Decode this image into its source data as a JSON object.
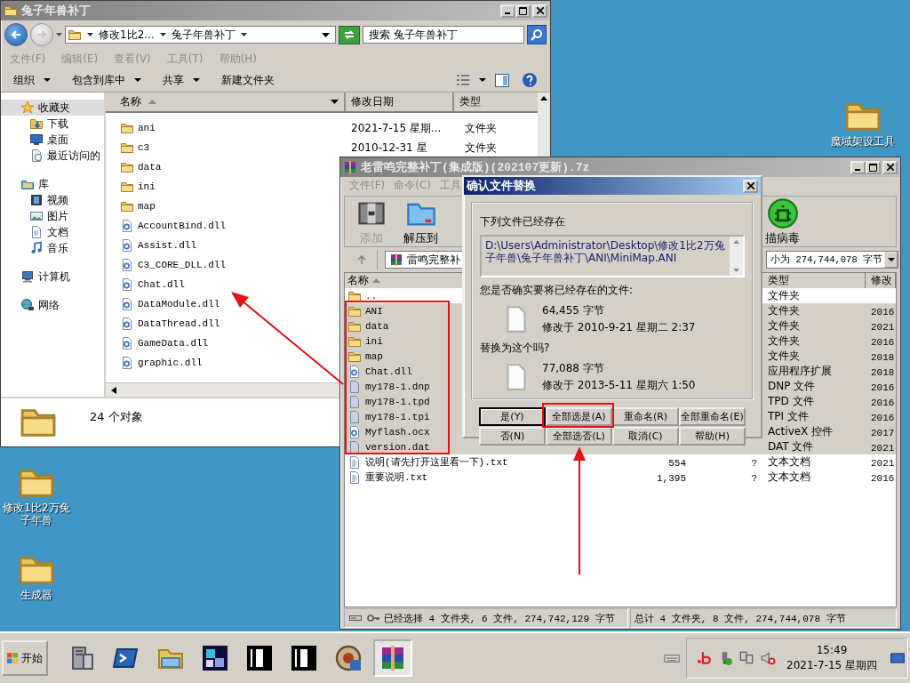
{
  "desktop": {
    "right_icons": [
      {
        "label": "魔域架设工具"
      }
    ],
    "left_icons": [
      {
        "label": "修改1比2万兔子年兽"
      },
      {
        "label": "生成器"
      }
    ]
  },
  "explorer": {
    "title": "兔子年兽补丁",
    "breadcrumbs": [
      "修改1比2...",
      "兔子年兽补丁"
    ],
    "search": {
      "placeholder": "搜索 兔子年兽补丁"
    },
    "menu": [
      "文件(F)",
      "编辑(E)",
      "查看(V)",
      "工具(T)",
      "帮助(H)"
    ],
    "toolbar": [
      {
        "label": "组织",
        "dropdown": true
      },
      {
        "label": "包含到库中",
        "dropdown": true
      },
      {
        "label": "共享",
        "dropdown": true
      },
      {
        "label": "新建文件夹",
        "dropdown": false
      }
    ],
    "sidebar": [
      {
        "label": "收藏夹",
        "kind": "star",
        "selected": true,
        "children": [
          {
            "label": "下载",
            "kind": "download"
          },
          {
            "label": "桌面",
            "kind": "desktop"
          },
          {
            "label": "最近访问的",
            "kind": "recent"
          }
        ]
      },
      {
        "label": "库",
        "kind": "library",
        "selected": false,
        "children": [
          {
            "label": "视频",
            "kind": "video"
          },
          {
            "label": "图片",
            "kind": "picture"
          },
          {
            "label": "文档",
            "kind": "document"
          },
          {
            "label": "音乐",
            "kind": "music"
          }
        ]
      },
      {
        "label": "计算机",
        "kind": "computer",
        "selected": false
      },
      {
        "label": "网络",
        "kind": "network",
        "selected": false
      }
    ],
    "columns": [
      {
        "label": "名称",
        "sorted": true
      },
      {
        "label": "修改日期",
        "sorted": false
      },
      {
        "label": "类型",
        "sorted": false
      }
    ],
    "files": [
      {
        "name": "ani",
        "kind": "folder",
        "date": "2021-7-15 星期...",
        "type": "文件夹"
      },
      {
        "name": "c3",
        "kind": "folder",
        "date": "2010-12-31 星",
        "type": "文件夹"
      },
      {
        "name": "data",
        "kind": "folder"
      },
      {
        "name": "ini",
        "kind": "folder"
      },
      {
        "name": "map",
        "kind": "folder"
      },
      {
        "name": "AccountBind.dll",
        "kind": "dll"
      },
      {
        "name": "Assist.dll",
        "kind": "dll"
      },
      {
        "name": "C3_CORE_DLL.dll",
        "kind": "dll"
      },
      {
        "name": "Chat.dll",
        "kind": "dll"
      },
      {
        "name": "DataModule.dll",
        "kind": "dll"
      },
      {
        "name": "DataThread.dll",
        "kind": "dll"
      },
      {
        "name": "GameData.dll",
        "kind": "dll"
      },
      {
        "name": "graphic.dll",
        "kind": "dll"
      }
    ],
    "status": "24 个对象"
  },
  "archiver": {
    "title": "老雷鸣完整补丁(集成版)(202107更新).7z",
    "menu": [
      "文件(F)",
      "命令(C)",
      "工具"
    ],
    "toolbar": [
      {
        "label": "添加",
        "kind": "add",
        "disabled": true
      },
      {
        "label": "解压到",
        "kind": "extract",
        "disabled": false
      },
      {
        "label": "描病毒",
        "kind": "scan",
        "disabled": false
      }
    ],
    "path": "雷鸣完整补",
    "size_summary": "小为 274,744,078 字节",
    "columns": [
      {
        "label": "名称",
        "sorted": true
      },
      {
        "label": "类型",
        "sorted": false
      },
      {
        "label": "修改"
      }
    ],
    "rows": [
      {
        "name": "..",
        "kind": "folder",
        "selected": false,
        "type": "文件夹"
      },
      {
        "name": "ANI",
        "kind": "folder",
        "selected": true,
        "type": "文件夹",
        "date": "2016"
      },
      {
        "name": "data",
        "kind": "folder",
        "selected": true,
        "type": "文件夹",
        "date": "2021"
      },
      {
        "name": "ini",
        "kind": "folder",
        "selected": true,
        "type": "文件夹",
        "date": "2016"
      },
      {
        "name": "map",
        "kind": "folder",
        "selected": true,
        "type": "文件夹",
        "date": "2018"
      },
      {
        "name": "Chat.dll",
        "kind": "dll",
        "selected": true,
        "type": "应用程序扩展",
        "date": "2018"
      },
      {
        "name": "my178-1.dnp",
        "kind": "file",
        "selected": true,
        "type": "DNP 文件",
        "date": "2016"
      },
      {
        "name": "my178-1.tpd",
        "kind": "file",
        "selected": true,
        "type": "TPD 文件",
        "date": "2016"
      },
      {
        "name": "my178-1.tpi",
        "kind": "file",
        "selected": true,
        "type": "TPI 文件",
        "date": "2016"
      },
      {
        "name": "Myflash.ocx",
        "kind": "dll",
        "selected": true,
        "type": "ActiveX 控件",
        "date": "2017"
      },
      {
        "name": "version.dat",
        "kind": "file",
        "selected": true,
        "type": "DAT 文件",
        "date": "2021"
      },
      {
        "name": "说明(请先打开这里看一下).txt",
        "kind": "text",
        "selected": false,
        "size": "554",
        "packed": "?",
        "type": "文本文档",
        "date": "2021"
      },
      {
        "name": "重要说明.txt",
        "kind": "text",
        "selected": false,
        "size": "1,395",
        "packed": "?",
        "type": "文本文档",
        "date": "2016"
      }
    ],
    "status_selected": "已经选择 4 文件夹, 6 文件, 274,742,129 字节",
    "status_total": "总计 4 文件夹, 8 文件, 274,744,078 字节"
  },
  "dialog": {
    "title": "确认文件替换",
    "exists_label": "下列文件已经存在",
    "path": "D:\\Users\\Administrator\\Desktop\\修改1比2万兔子年兽\\兔子年兽补丁\\ANI\\MiniMap.ANI",
    "question": "您是否确实要将已经存在的文件:",
    "existing": {
      "size": "64,455 字节",
      "modified": "修改于 2010-9-21 星期二 2:37"
    },
    "replace_label": "替换为这个吗?",
    "incoming": {
      "size": "77,088 字节",
      "modified": "修改于 2013-5-11 星期六 1:50"
    },
    "buttons": [
      {
        "label": "是(Y)",
        "default": true
      },
      {
        "label": "全部选是(A)",
        "default": false
      },
      {
        "label": "重命名(R)",
        "default": false
      },
      {
        "label": "全部重命名(E)",
        "default": false
      },
      {
        "label": "否(N)",
        "default": false
      },
      {
        "label": "全部选否(L)",
        "default": false
      },
      {
        "label": "取消(C)",
        "default": false
      },
      {
        "label": "帮助(H)",
        "default": false
      }
    ]
  },
  "taskbar": {
    "start": "开始",
    "apps": [
      {
        "kind": "server",
        "active": false
      },
      {
        "kind": "terminal",
        "active": false
      },
      {
        "kind": "explorer",
        "active": false
      },
      {
        "kind": "cubes",
        "active": false
      },
      {
        "kind": "tile",
        "active": false
      },
      {
        "kind": "tile",
        "active": false
      },
      {
        "kind": "disc",
        "active": false
      },
      {
        "kind": "archive",
        "active": true
      }
    ],
    "clock": {
      "time": "15:49",
      "date": "2021-7-15 星期四"
    }
  }
}
